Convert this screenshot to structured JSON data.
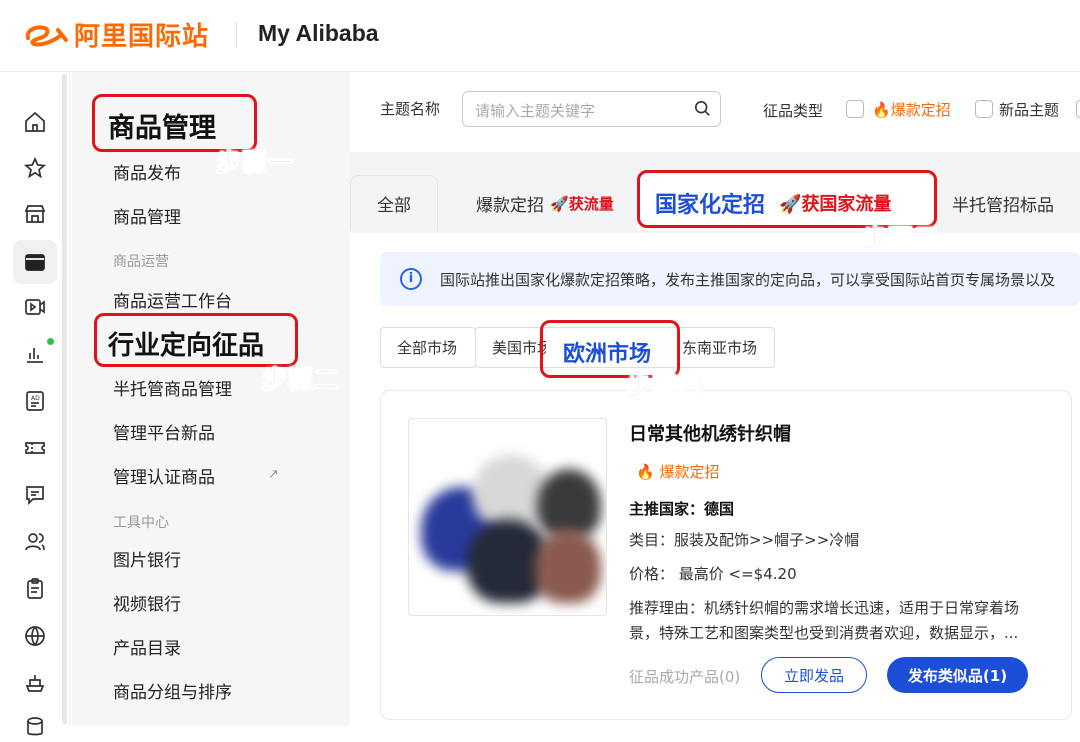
{
  "header": {
    "logo_text": "阿里国际站",
    "title": "My Alibaba"
  },
  "rail": {
    "icons": [
      "home-icon",
      "star-icon",
      "store-icon",
      "box-icon",
      "video-icon",
      "chart-icon",
      "ad-icon",
      "ticket-icon",
      "message-icon",
      "users-icon",
      "clipboard-icon",
      "globe-icon",
      "ship-icon",
      "database-icon"
    ]
  },
  "sidenav": {
    "section_title": "商品管理",
    "items": [
      "商品发布",
      "商品管理"
    ],
    "group_ops": "商品运营",
    "ops_items": [
      "商品运营工作台",
      "行业定向征品",
      "半托管商品管理",
      "管理平台新品",
      "管理认证商品"
    ],
    "ext_arrow": "↗",
    "group_tools": "工具中心",
    "tool_items": [
      "图片银行",
      "视频银行",
      "产品目录",
      "商品分组与排序"
    ]
  },
  "annotations": {
    "step1": "步骤一",
    "step2": "步骤二",
    "step3": "步骤三",
    "step4": "步骤四"
  },
  "filters": {
    "topic_label": "主题名称",
    "topic_placeholder": "请输入主题关键字",
    "type_label": "征品类型",
    "type_hot": "爆款定招",
    "type_new": "新品主题"
  },
  "tabs": {
    "all": "全部",
    "hot": "爆款定招",
    "hot_sub": "获流量",
    "national": "国家化定招",
    "national_sub": "获国家流量",
    "semi": "半托管招标品"
  },
  "notice": "国际站推出国家化爆款定招策略，发布主推国家的定向品，可以享受国际站首页专属场景以及",
  "markets": [
    "全部市场",
    "美国市场",
    "欧洲市场",
    "东南亚市场"
  ],
  "product": {
    "title": "日常其他机绣针织帽",
    "badge": "爆款定招",
    "country": "主推国家：德国",
    "category": "类目：服装及配饰>>帽子>>冷帽",
    "price": "价格：  最高价 <=$4.20",
    "reason_line1": "推荐理由：机绣针织帽的需求增长迅速，适用于日常穿着场",
    "reason_line2": "景，特殊工艺和图案类型也受到消费者欢迎，数据显示，...",
    "success": "征品成功产品(0)",
    "btn_publish": "立即发品",
    "btn_similar": "发布类似品(1)"
  },
  "colors": {
    "brand": "#ff6a00",
    "annotation": "#e0131b",
    "primary": "#1d4ed8"
  }
}
